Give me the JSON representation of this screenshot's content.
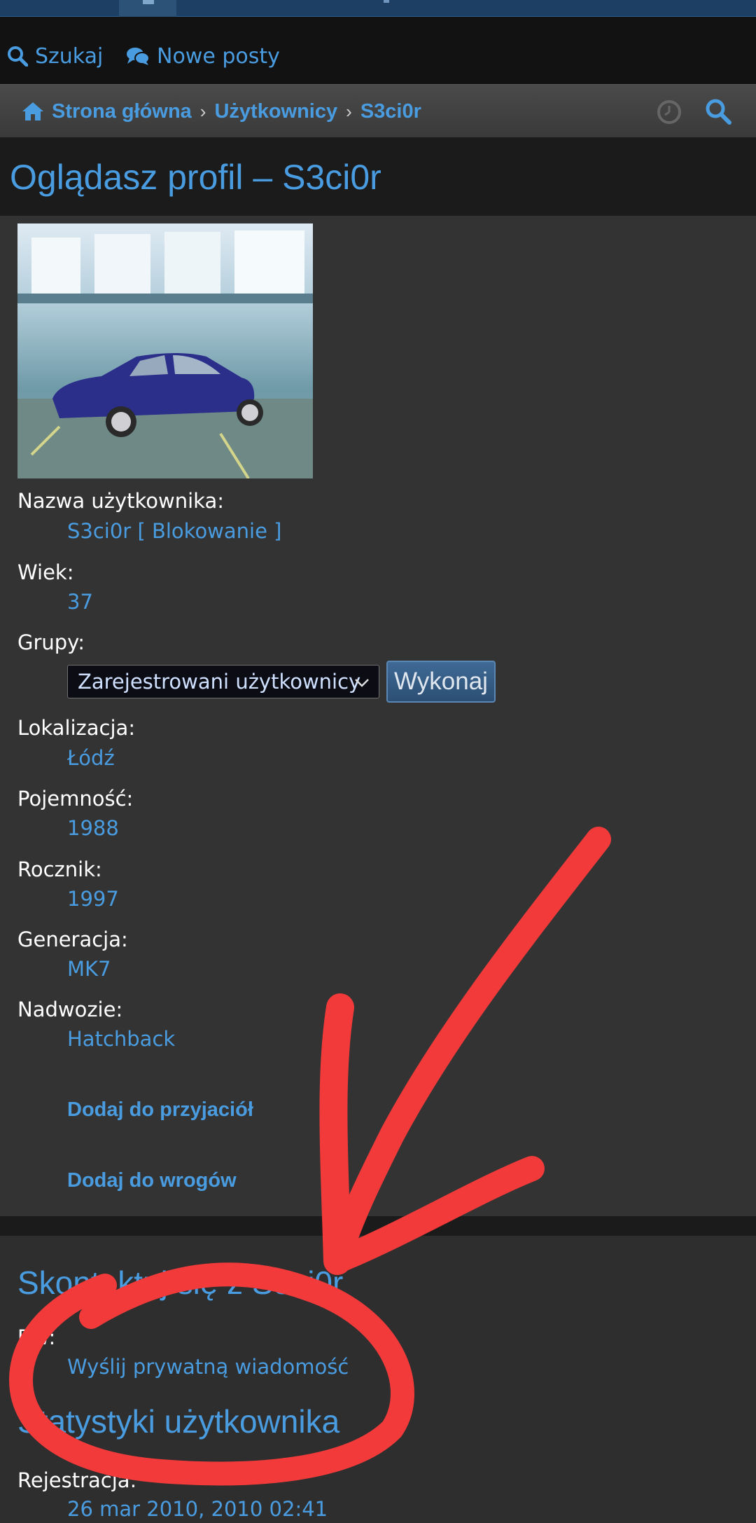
{
  "quick_nav": {
    "search_label": "Szukaj",
    "new_posts_label": "Nowe posty"
  },
  "breadcrumb": {
    "home": "Strona główna",
    "users": "Użytkownicy",
    "current": "S3ci0r"
  },
  "page": {
    "title": "Oglądasz profil – S3ci0r"
  },
  "profile": {
    "username_label": "Nazwa użytkownika:",
    "username_value": "S3ci0r [ Blokowanie ]",
    "age_label": "Wiek:",
    "age_value": "37",
    "groups_label": "Grupy:",
    "groups_selected": "Zarejestrowani użytkownicy",
    "execute_button": "Wykonaj",
    "location_label": "Lokalizacja:",
    "location_value": "Łódź",
    "capacity_label": "Pojemność:",
    "capacity_value": "1988",
    "year_label": "Rocznik:",
    "year_value": "1997",
    "generation_label": "Generacja:",
    "generation_value": "MK7",
    "body_label": "Nadwozie:",
    "body_value": "Hatchback",
    "add_friend": "Dodaj do przyjaciół",
    "add_foe": "Dodaj do wrogów"
  },
  "contact": {
    "title": "Skontaktuj się z S3ci0r",
    "pm_label": "PW:",
    "pm_link": "Wyślij prywatną wiadomość"
  },
  "stats": {
    "title": "Statystyki użytkownika",
    "registered_label": "Rejestracja:",
    "registered_value": "26 mar 2010, 2010 02:41"
  },
  "colors": {
    "link": "#4a9ce0",
    "panel": "#333333",
    "annotation": "#f23a3a"
  }
}
